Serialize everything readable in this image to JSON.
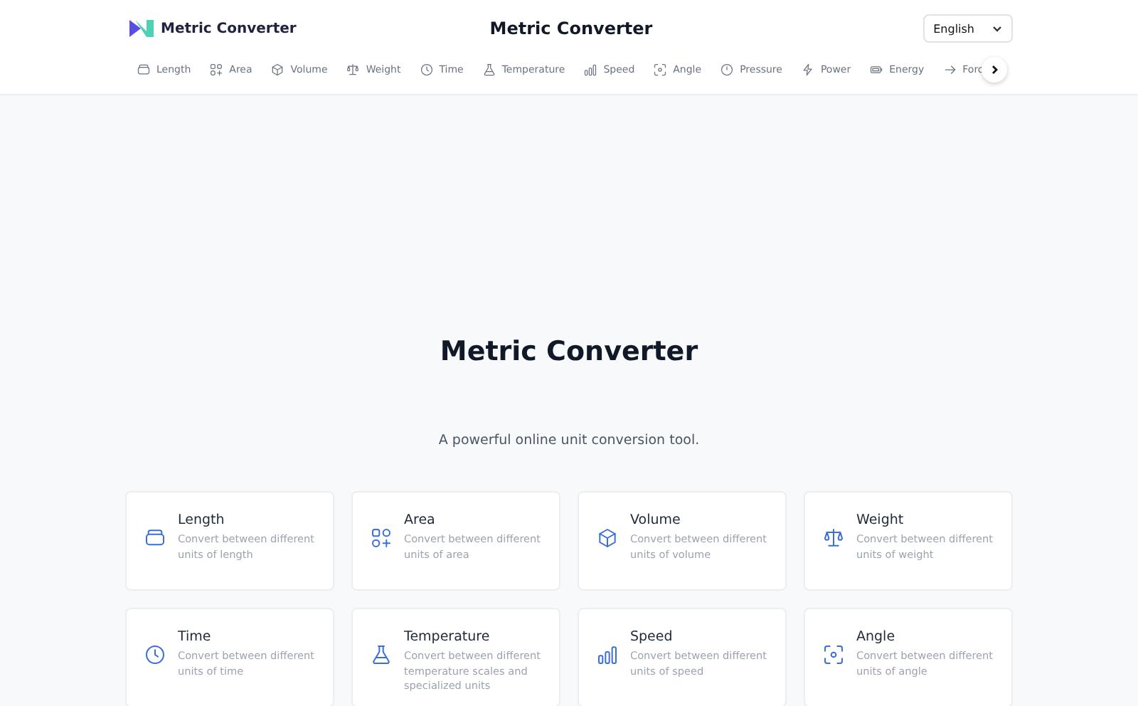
{
  "brand": {
    "name": "Metric Converter"
  },
  "header_title": "Metric Converter",
  "language": {
    "value": "English"
  },
  "nav": [
    {
      "label": "Length"
    },
    {
      "label": "Area"
    },
    {
      "label": "Volume"
    },
    {
      "label": "Weight"
    },
    {
      "label": "Time"
    },
    {
      "label": "Temperature"
    },
    {
      "label": "Speed"
    },
    {
      "label": "Angle"
    },
    {
      "label": "Pressure"
    },
    {
      "label": "Power"
    },
    {
      "label": "Energy"
    },
    {
      "label": "Forc"
    }
  ],
  "hero": {
    "title": "Metric Converter",
    "subtitle": "A powerful online unit conversion tool."
  },
  "cards": [
    {
      "title": "Length",
      "description": "Convert between different units of length"
    },
    {
      "title": "Area",
      "description": "Convert between different units of area"
    },
    {
      "title": "Volume",
      "description": "Convert between different units of volume"
    },
    {
      "title": "Weight",
      "description": "Convert between different units of weight"
    },
    {
      "title": "Time",
      "description": "Convert between different units of time"
    },
    {
      "title": "Temperature",
      "description": "Convert between different temperature scales and specialized units"
    },
    {
      "title": "Speed",
      "description": "Convert between different units of speed"
    },
    {
      "title": "Angle",
      "description": "Convert between different units of angle"
    }
  ]
}
